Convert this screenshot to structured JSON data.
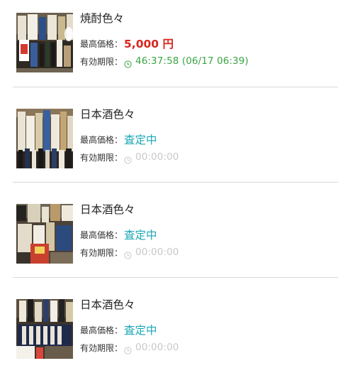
{
  "labels": {
    "price": "最高価格：",
    "expire": "有効期限："
  },
  "colors": {
    "price_red": "#d6261f",
    "pending_teal": "#1aa7b5",
    "time_green": "#3aa543",
    "time_gray": "#c8c8c8",
    "divider": "#d9d9d9"
  },
  "items": [
    {
      "title": "焼酎色々",
      "price": "5,000 円",
      "price_state": "bid",
      "expire": "46:37:58 (06/17 06:39)",
      "expire_state": "active",
      "icon": "clock-icon"
    },
    {
      "title": "日本酒色々",
      "price": "査定中",
      "price_state": "pending",
      "expire": "00:00:00",
      "expire_state": "inactive",
      "icon": "clock-icon"
    },
    {
      "title": "日本酒色々",
      "price": "査定中",
      "price_state": "pending",
      "expire": "00:00:00",
      "expire_state": "inactive",
      "icon": "clock-icon"
    },
    {
      "title": "日本酒色々",
      "price": "査定中",
      "price_state": "pending",
      "expire": "00:00:00",
      "expire_state": "inactive",
      "icon": "clock-icon"
    }
  ]
}
